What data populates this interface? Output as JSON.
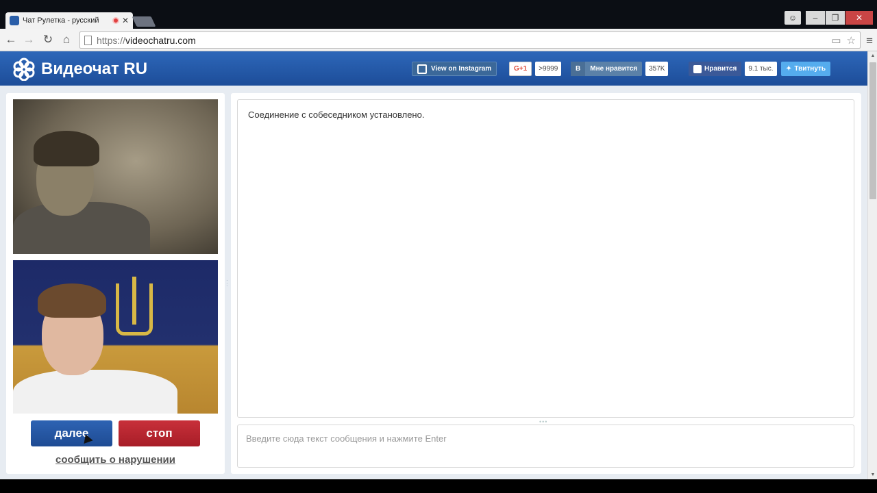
{
  "browser": {
    "tab_title": "Чат Рулетка - русский",
    "tab_close": "✕",
    "url_scheme": "https://",
    "url_host": "videochatru.com",
    "window_controls": {
      "minimize": "–",
      "maximize": "❐",
      "close": "✕"
    },
    "nav": {
      "back": "←",
      "forward": "→",
      "reload": "↻",
      "home": "⌂",
      "menu": "≡",
      "star": "☆"
    }
  },
  "header": {
    "logo_text": "Видеочат RU",
    "instagram_label": "View on Instagram",
    "gplus_label": "G+1",
    "gplus_count": ">9999",
    "vk_b": "В",
    "vk_label": "Мне нравится",
    "vk_count": "357K",
    "fb_label": "Нравится",
    "fb_count": "9.1 тыс.",
    "tw_label": "Твитнуть"
  },
  "controls": {
    "next_label": "далее",
    "stop_label": "стоп",
    "report_label": "сообщить о нарушении"
  },
  "chat": {
    "system_message": "Соединение с собеседником установлено.",
    "input_placeholder": "Введите сюда текст сообщения и нажмите Enter",
    "input_value": ""
  },
  "colors": {
    "header_blue": "#2d67b9",
    "next_blue": "#2e63b3",
    "stop_red": "#c8303a",
    "facebook": "#3b5998",
    "twitter": "#55acee",
    "vk": "#5b81a8"
  }
}
